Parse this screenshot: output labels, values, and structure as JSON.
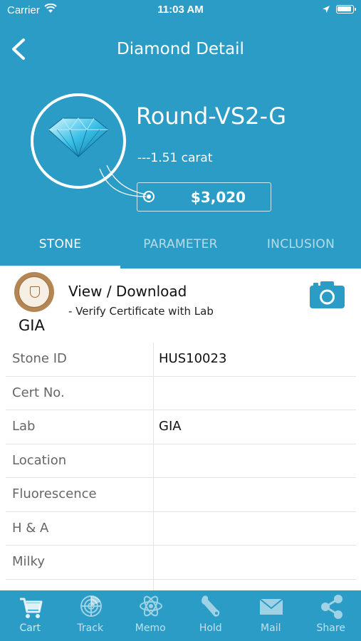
{
  "status_bar": {
    "carrier": "Carrier",
    "time": "11:03 AM"
  },
  "nav": {
    "title": "Diamond Detail"
  },
  "stone": {
    "name": "Round-VS2-G",
    "carat": "---1.51 carat",
    "price": "$3,020"
  },
  "tabs": [
    {
      "label": "STONE",
      "active": true
    },
    {
      "label": "PARAMETER",
      "active": false
    },
    {
      "label": "INCLUSION",
      "active": false
    }
  ],
  "certificate": {
    "lab": "GIA",
    "title": "View / Download",
    "subtitle": "- Verify Certificate with Lab"
  },
  "details": [
    {
      "label": "Stone ID",
      "value": "HUS10023"
    },
    {
      "label": "Cert No.",
      "value": ""
    },
    {
      "label": "Lab",
      "value": "GIA"
    },
    {
      "label": "Location",
      "value": ""
    },
    {
      "label": "Fluorescence",
      "value": ""
    },
    {
      "label": "H & A",
      "value": ""
    },
    {
      "label": "Milky",
      "value": ""
    }
  ],
  "tab_bar": [
    {
      "label": "Cart",
      "icon": "cart-icon"
    },
    {
      "label": "Track",
      "icon": "radar-icon"
    },
    {
      "label": "Memo",
      "icon": "atom-icon"
    },
    {
      "label": "Hold",
      "icon": "wrench-icon"
    },
    {
      "label": "Mail",
      "icon": "mail-icon"
    },
    {
      "label": "Share",
      "icon": "share-icon"
    }
  ],
  "colors": {
    "brand": "#2a9cc6",
    "text": "#111111",
    "label": "#666666"
  }
}
